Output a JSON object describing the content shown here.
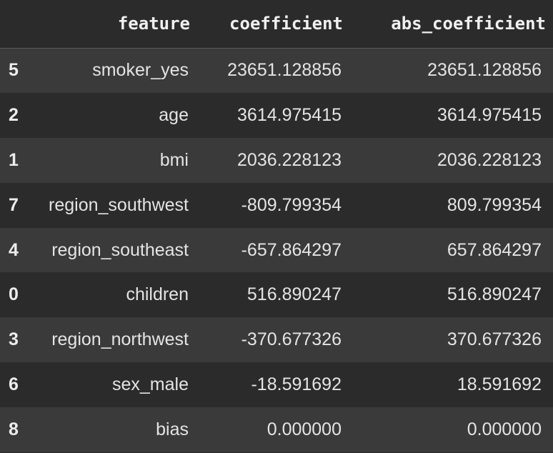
{
  "table": {
    "headers": [
      "",
      "feature",
      "coefficient",
      "abs_coefficient"
    ],
    "rows": [
      {
        "index": "5",
        "feature": "smoker_yes",
        "coefficient": "23651.128856",
        "abs_coefficient": "23651.128856"
      },
      {
        "index": "2",
        "feature": "age",
        "coefficient": "3614.975415",
        "abs_coefficient": "3614.975415"
      },
      {
        "index": "1",
        "feature": "bmi",
        "coefficient": "2036.228123",
        "abs_coefficient": "2036.228123"
      },
      {
        "index": "7",
        "feature": "region_southwest",
        "coefficient": "-809.799354",
        "abs_coefficient": "809.799354"
      },
      {
        "index": "4",
        "feature": "region_southeast",
        "coefficient": "-657.864297",
        "abs_coefficient": "657.864297"
      },
      {
        "index": "0",
        "feature": "children",
        "coefficient": "516.890247",
        "abs_coefficient": "516.890247"
      },
      {
        "index": "3",
        "feature": "region_northwest",
        "coefficient": "-370.677326",
        "abs_coefficient": "370.677326"
      },
      {
        "index": "6",
        "feature": "sex_male",
        "coefficient": "-18.591692",
        "abs_coefficient": "18.591692"
      },
      {
        "index": "8",
        "feature": "bias",
        "coefficient": "0.000000",
        "abs_coefficient": "0.000000"
      }
    ]
  },
  "colors": {
    "background": "#2b2b2b",
    "stripe": "#3a3a3a",
    "text": "#e4e4e4"
  }
}
